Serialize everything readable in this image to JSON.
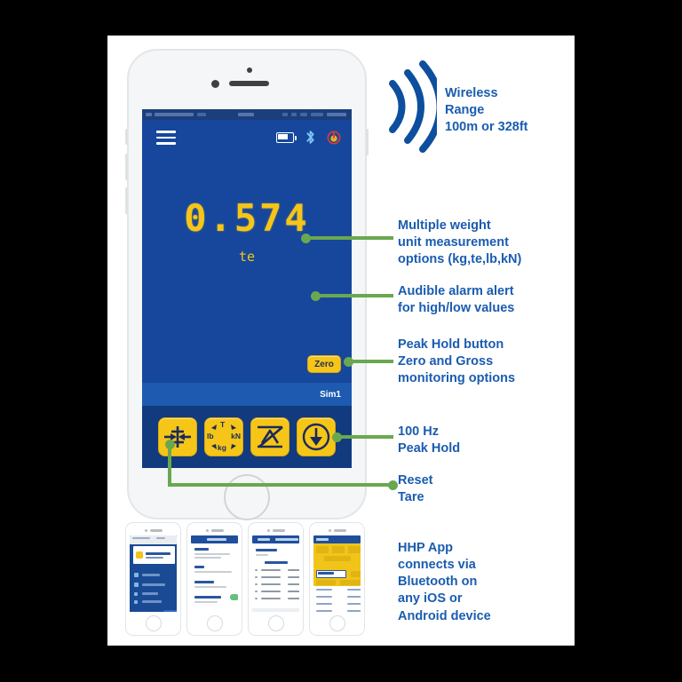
{
  "colors": {
    "brand_blue": "#1a5cb0",
    "arc_blue": "#0d4f9e",
    "screen_blue": "#16479d",
    "accent_yellow": "#f5c518",
    "connector_green": "#6aa84f",
    "page_background": "#000000",
    "card_background": "#ffffff"
  },
  "wireless": {
    "icon": "wireless-waves-icon",
    "line1": "Wireless",
    "line2": "Range",
    "line3": "100m or 328ft"
  },
  "phone": {
    "app_bar": {
      "menu_icon": "hamburger-menu-icon",
      "battery_icon": "battery-icon",
      "bluetooth_icon": "bluetooth-icon",
      "power_icon": "power-alarm-icon"
    },
    "display": {
      "value": "0.574",
      "unit": "te"
    },
    "zero_button": "Zero",
    "channel_label": "Sim1",
    "function_buttons": [
      {
        "name": "tare-button",
        "icon": "tare-arrows-icon"
      },
      {
        "name": "units-button",
        "icon": "units-selector-icon",
        "units": {
          "top": "T",
          "left": "lb",
          "right": "kN",
          "bottom": "kg"
        }
      },
      {
        "name": "peak-graph-button",
        "icon": "peak-graph-icon"
      },
      {
        "name": "peak-hold-button",
        "icon": "peak-hold-down-arrow-icon"
      }
    ]
  },
  "annotations": {
    "units": {
      "line1": "Multiple weight",
      "line2": "unit measurement",
      "line3": "options (kg,te,lb,kN)"
    },
    "alarm": {
      "line1": "Audible alarm alert",
      "line2": "for high/low values"
    },
    "peak": {
      "line1": "Peak Hold button",
      "line2": "Zero and Gross",
      "line3": "monitoring options"
    },
    "hz": {
      "line1": "100 Hz",
      "line2": "Peak Hold"
    },
    "reset": {
      "line1": "Reset",
      "line2": "Tare"
    },
    "hhp": {
      "line1": "HHP App",
      "line2": "connects via",
      "line3": "Bluetooth on",
      "line4": "any iOS or",
      "line5": "Android device"
    }
  },
  "thumbnails": [
    {
      "name": "thumbnail-dashboard",
      "theme": "blue"
    },
    {
      "name": "thumbnail-settings",
      "theme": "white"
    },
    {
      "name": "thumbnail-readings-list",
      "theme": "white"
    },
    {
      "name": "thumbnail-data-table",
      "theme": "yellow"
    }
  ]
}
